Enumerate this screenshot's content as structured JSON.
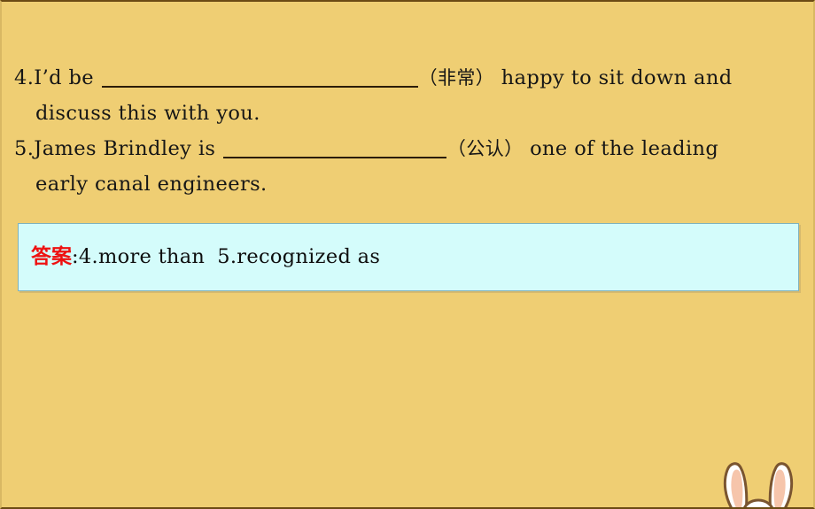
{
  "slide": {
    "background_color": "#efce73",
    "questions": [
      {
        "number": "4.",
        "text_before_blank": "I’d be ",
        "blank": "",
        "hint": "（非常）",
        "text_after_blank": " happy to sit down and",
        "continuation": "discuss this with you."
      },
      {
        "number": "5.",
        "text_before_blank": "James Brindley is ",
        "blank": "",
        "hint": "（公认）",
        "text_after_blank": " one of the leading",
        "continuation": "early canal engineers."
      }
    ],
    "answer_box": {
      "label": "答案",
      "separator": ":",
      "answers": [
        "4.more than",
        "5.recognized as"
      ],
      "label_color": "#ee1111",
      "fill_color": "#d4fcfb",
      "border_color": "#7fb2bd"
    },
    "decoration": {
      "name": "bunny-ears",
      "outline_color": "#7a5530",
      "fill_color": "#ffffff",
      "inner_color": "#f6c5ab"
    }
  }
}
